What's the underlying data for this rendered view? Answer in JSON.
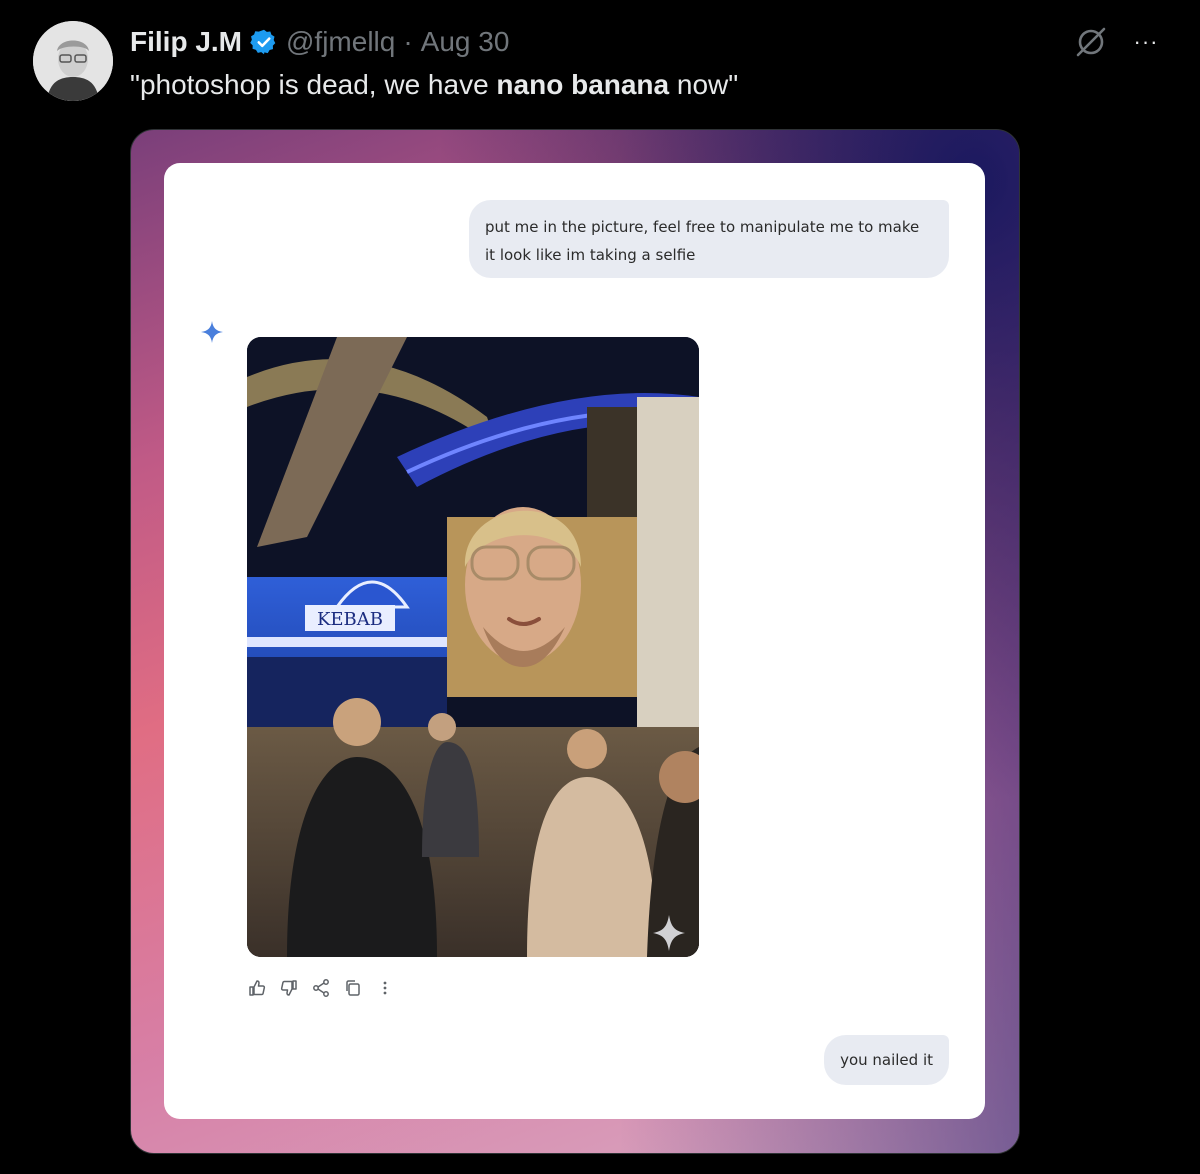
{
  "tweet": {
    "display_name": "Filip J.M",
    "handle": "@fjmellq",
    "separator": "·",
    "date": "Aug 30",
    "text_prefix": "\"photoshop is dead, we have ",
    "text_bold": "nano banana",
    "text_suffix": " now\"",
    "verified_color": "#1d9bf0"
  },
  "icons": {
    "avatar": "avatar",
    "verified": "verified-badge-icon",
    "grok": "grok-icon",
    "more": "more-icon"
  },
  "chat": {
    "user_message_1": "put me in the picture, feel free to manipulate me to make it look like im taking a selfie",
    "image_sign": "KEBAB",
    "user_message_2": "you nailed it",
    "accent": "#4a7fdc",
    "action_icons": [
      "thumbs-up-icon",
      "thumbs-down-icon",
      "share-icon",
      "copy-icon",
      "more-vertical-icon"
    ]
  },
  "more_label": "···"
}
